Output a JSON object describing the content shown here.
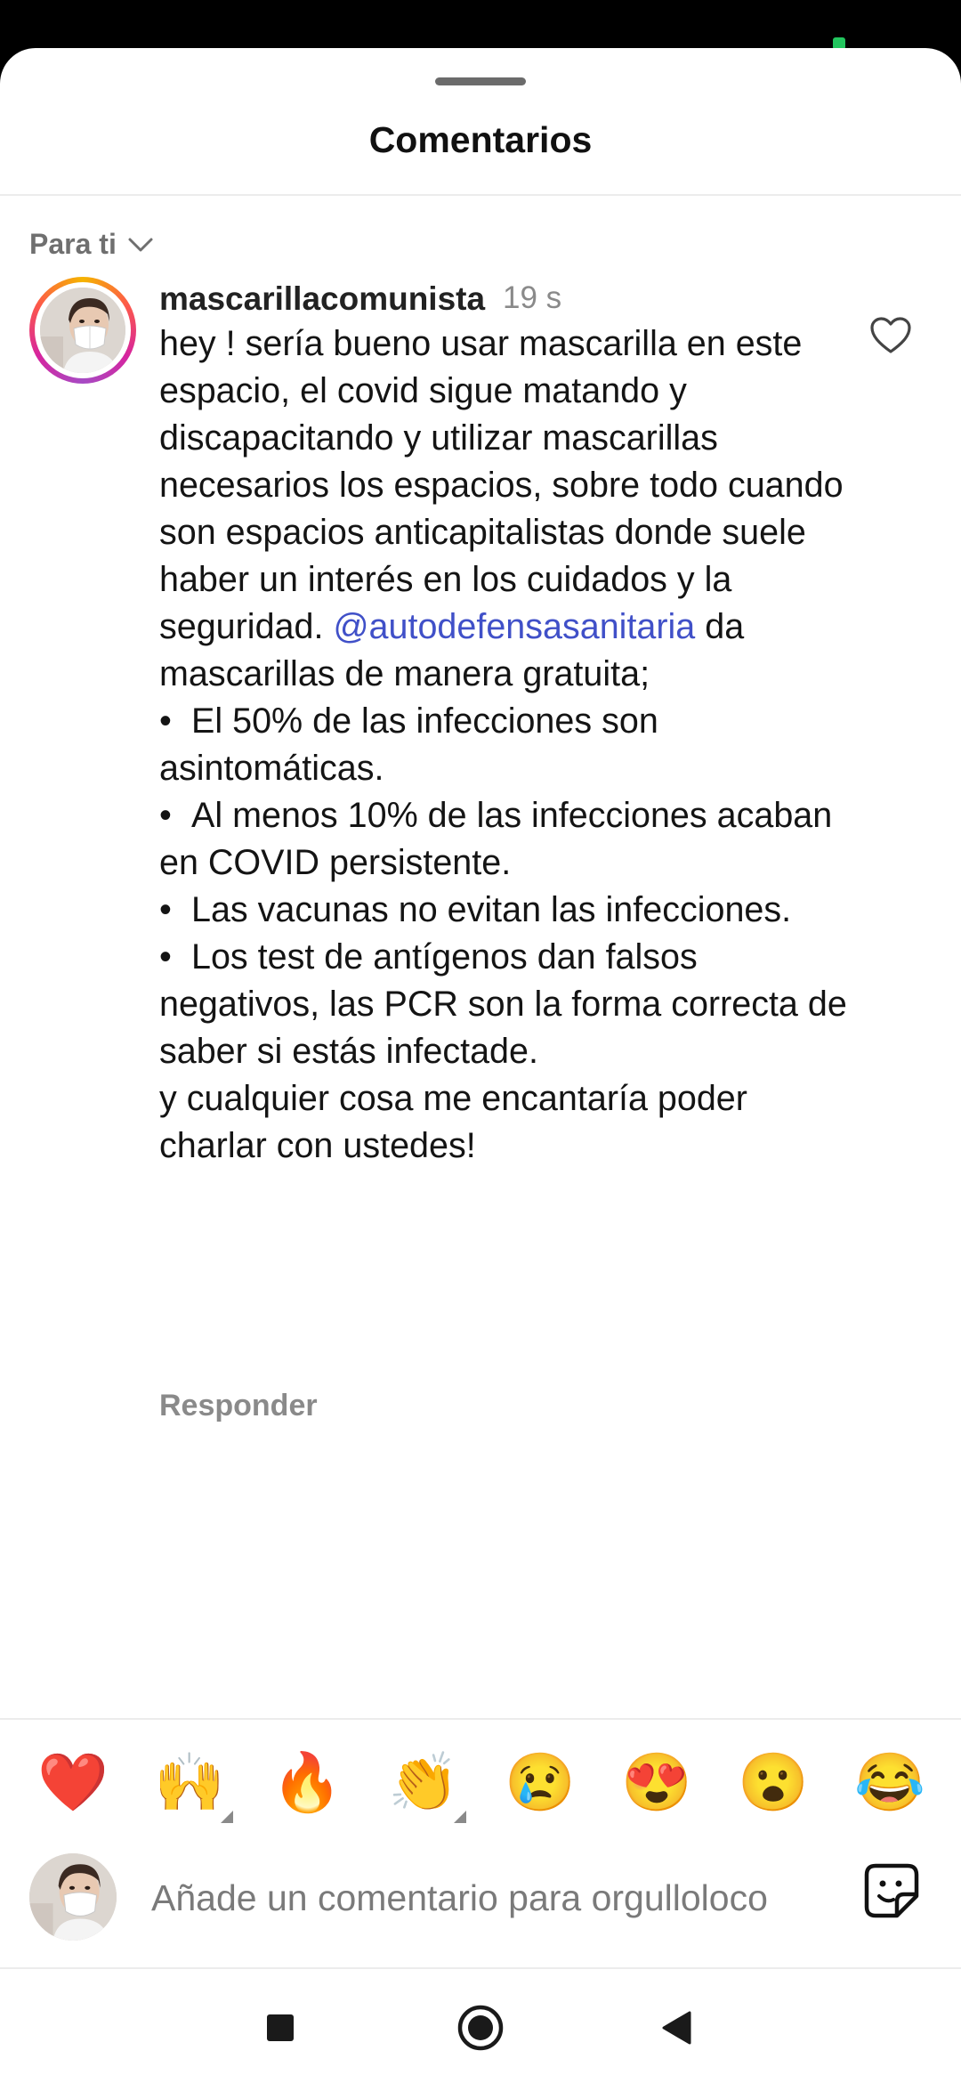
{
  "header": {
    "title": "Comentarios"
  },
  "sort": {
    "label": "Para ti",
    "icon": "chevron-down-icon"
  },
  "comment": {
    "username": "mascarillacomunista",
    "timestamp": "19 s",
    "text_lead": "hey ! sería bueno usar mascarilla en este espacio, el covid sigue matando y discapacitando y utilizar mascarillas necesarios los espacios, sobre todo cuando son espacios anticapitalistas donde suele haber un interés en los cuidados y la seguridad. ",
    "mention": "@autodefensasanitaria",
    "text_after_mention": " da mascarillas de manera gratuita;",
    "bullet_char": "•",
    "bullets": [
      "El 50% de las infecciones son asintomáticas.",
      "Al menos 10% de las infecciones acaban en COVID persistente.",
      "Las vacunas no evitan las infecciones.",
      "Los test de antígenos dan falsos negativos, las PCR son la forma correcta de saber si estás infectade."
    ],
    "closing": "y cualquier cosa me encantaría poder charlar con ustedes!",
    "reply_label": "Responder",
    "like_icon": "heart-outline-icon"
  },
  "quick_reactions": [
    "❤️",
    "🙌",
    "🔥",
    "👏",
    "😢",
    "😍",
    "😮",
    "😂"
  ],
  "composer": {
    "placeholder": "Añade un comentario para orgulloloco",
    "sticker_icon": "sticker-icon"
  },
  "system_nav": [
    "recents-square-icon",
    "home-circle-icon",
    "back-triangle-icon"
  ],
  "colors": {
    "mention": "#4050c8",
    "like_outline": "#111111",
    "reaction_heart": "#e0243a"
  }
}
